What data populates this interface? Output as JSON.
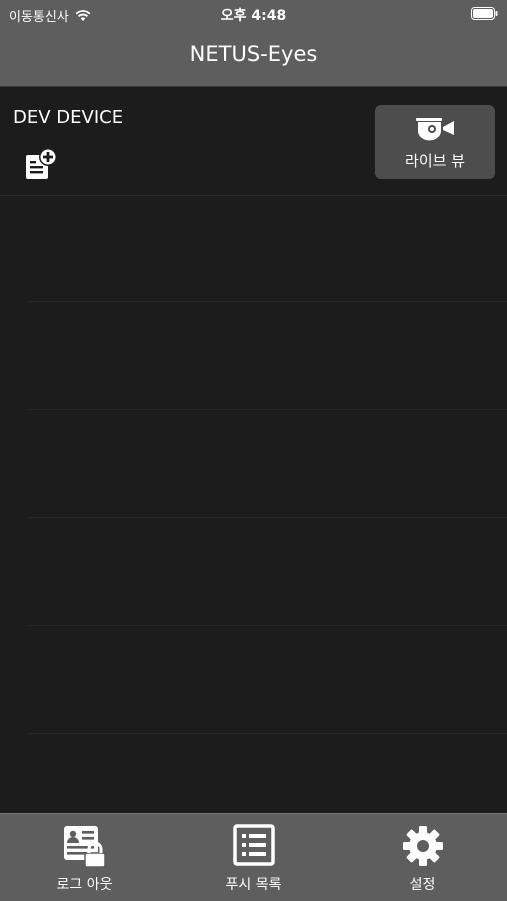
{
  "status": {
    "carrier": "이동통신사",
    "time": "오후 4:48"
  },
  "nav": {
    "title": "NETUS-Eyes"
  },
  "device": {
    "name": "DEV DEVICE",
    "live_label": "라이브 뷰"
  },
  "tabs": [
    {
      "label": "로그 아웃",
      "icon": "logout-lock-icon"
    },
    {
      "label": "푸시 목록",
      "icon": "list-icon"
    },
    {
      "label": "설정",
      "icon": "gear-icon"
    }
  ],
  "colors": {
    "bar": "#5e5e5e",
    "background": "#1c1c1c",
    "button": "#4d4d4d"
  }
}
